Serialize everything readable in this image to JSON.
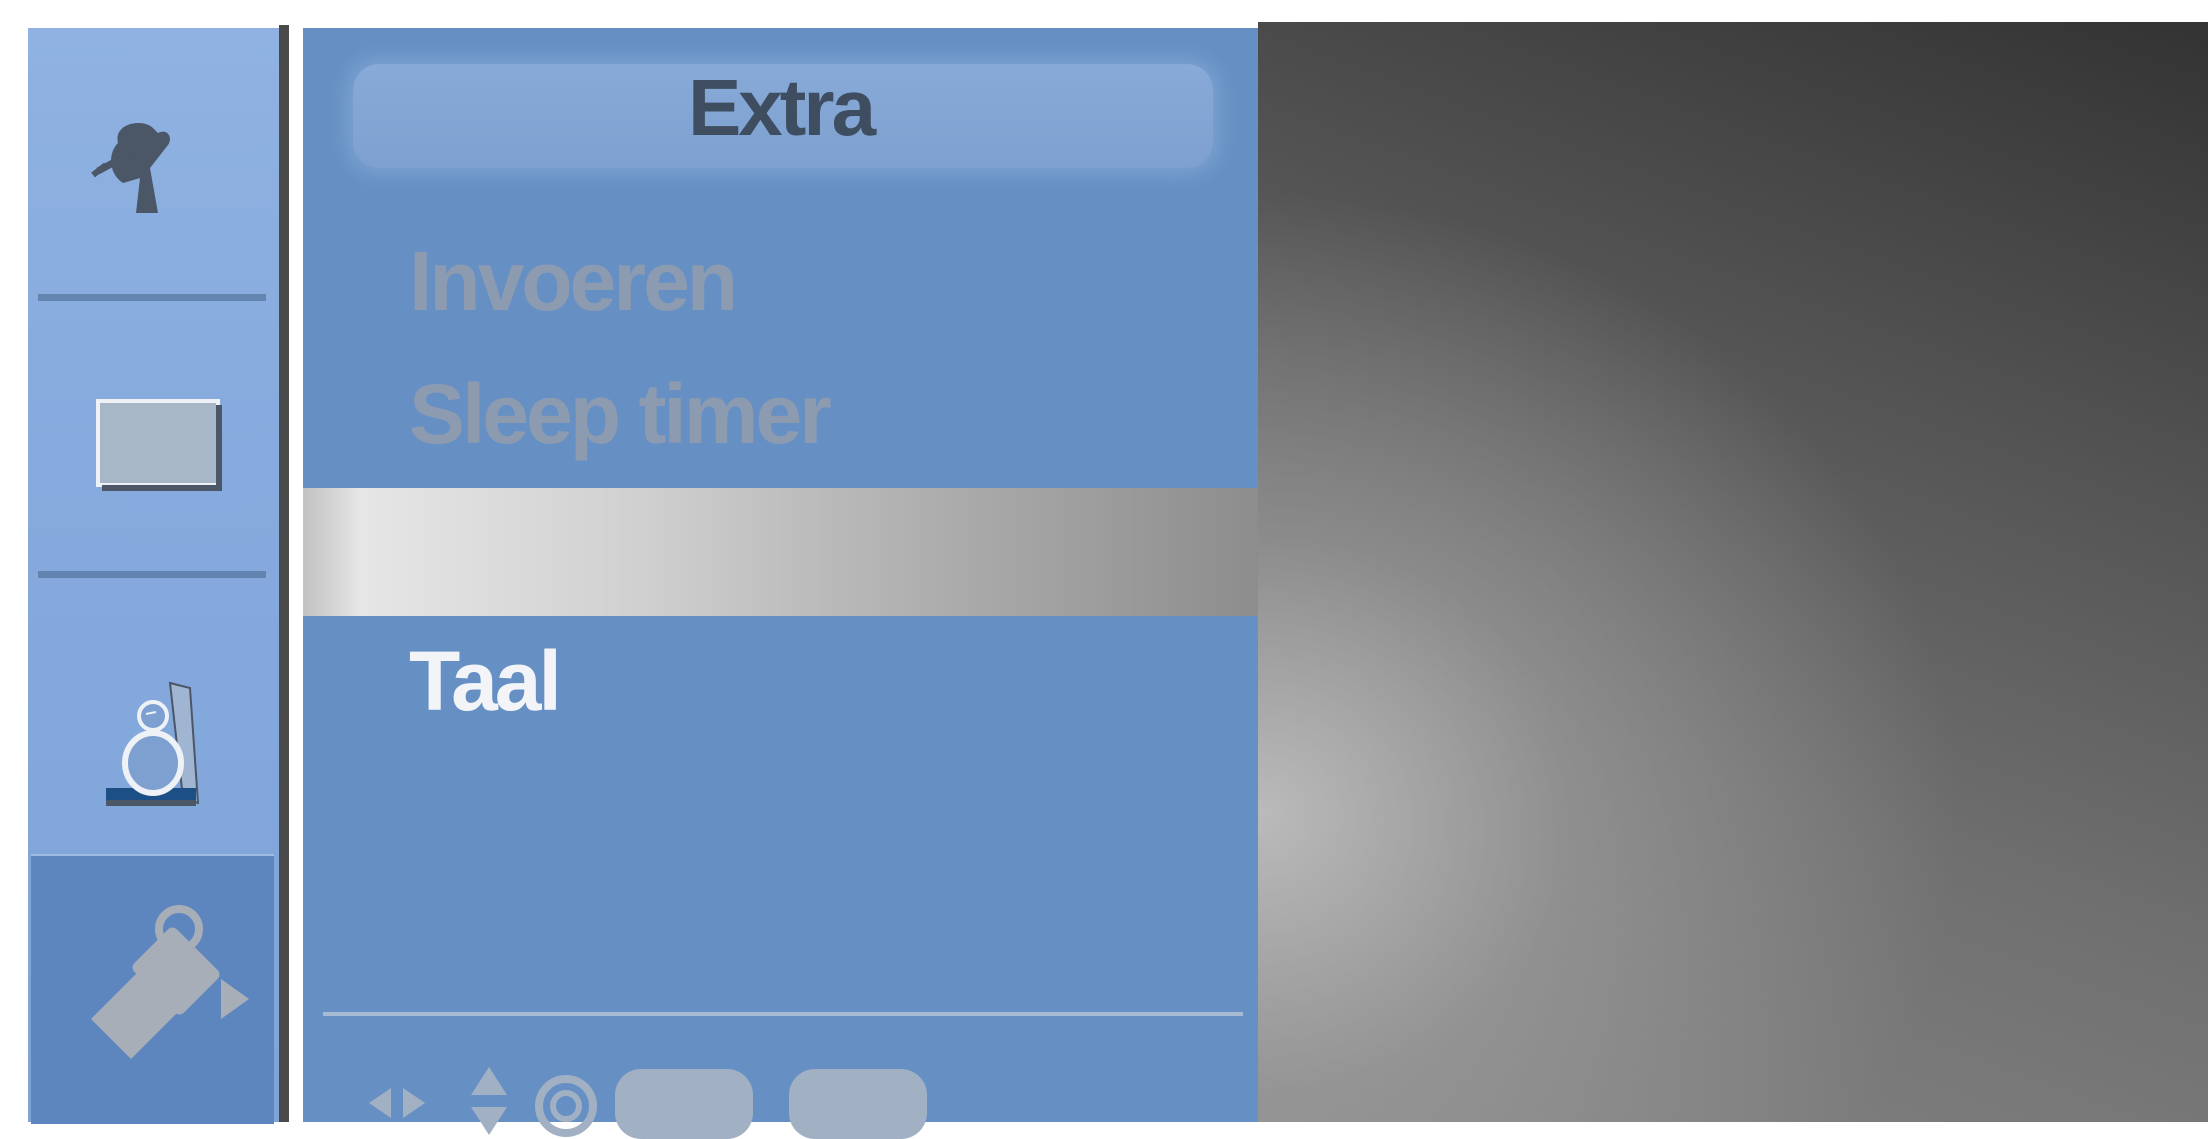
{
  "menu": {
    "title": "Extra",
    "items": [
      {
        "label": "Invoeren",
        "state": "disabled"
      },
      {
        "label": "Sleep timer",
        "state": "disabled"
      },
      {
        "label": "",
        "state": "highlighted"
      },
      {
        "label": "Taal",
        "state": "enabled"
      }
    ]
  },
  "sidebar": {
    "items": [
      {
        "icon": "satellite-dish-icon",
        "selected": false
      },
      {
        "icon": "screen-icon",
        "selected": false
      },
      {
        "icon": "person-icon",
        "selected": false
      },
      {
        "icon": "tag-icon",
        "selected": true
      }
    ]
  },
  "nav_hints": {
    "icons": [
      "left-right-arrows-icon",
      "up-down-arrows-icon",
      "ok-circle-icon"
    ],
    "buttons": [
      "",
      ""
    ]
  },
  "colors": {
    "panel": "#6690c3",
    "sidebar": "#86aadd",
    "highlight": "#d0d0d0",
    "text_enabled": "#f2f4f8",
    "text_disabled": "#8d9bb1",
    "title_text": "#3f4d60"
  }
}
